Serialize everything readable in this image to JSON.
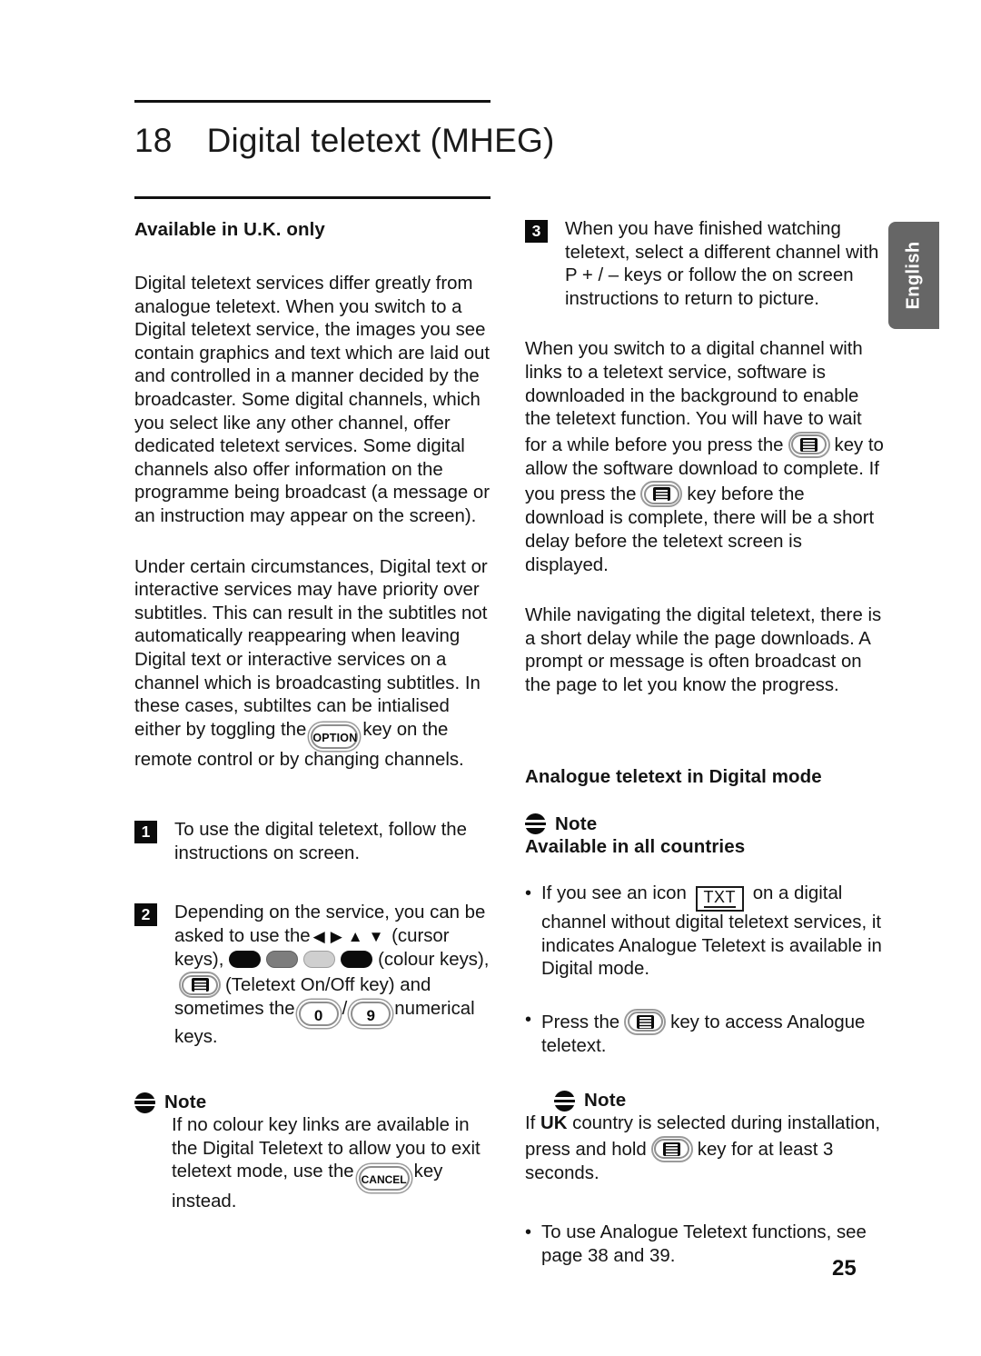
{
  "header": {
    "chapter_number": "18",
    "chapter_title": "Digital teletext (MHEG)"
  },
  "language_tab": {
    "label": "English"
  },
  "page_number": "25",
  "left_column": {
    "section_heading": "Available in U.K. only",
    "paragraph_1": "Digital teletext services differ greatly from analogue teletext. When you switch to a Digital teletext service, the images you see contain graphics and text which are laid out and controlled in a manner decided by the broadcaster. Some digital channels, which you select like any other channel, offer dedicated teletext services. Some digital channels also offer information on the programme being broadcast (a message or an instruction may appear on the screen).",
    "paragraph_2_part_1": "Under certain circumstances, Digital text or interactive services may have priority over subtitles. This can result in the subtitles not automatically reappearing when leaving Digital text or interactive services on a channel which is broadcasting subtitles. In these cases, subtiltes can be intialised either by toggling the",
    "paragraph_2_part_2": "key on the remote control or by changing channels.",
    "option_key_label": "OPTION",
    "step_1": {
      "number": "1",
      "text": "To use the digital teletext, follow the instructions on screen."
    },
    "step_2": {
      "number": "2",
      "text_part_1": "Depending on the service, you can be asked to use the",
      "text_part_2": "(cursor keys),",
      "text_part_3": "(colour keys),",
      "text_part_4": "(Teletext On/Off key) and",
      "text_part_5": "sometimes the",
      "text_part_6": "/",
      "text_part_7": "numerical keys.",
      "cursor_left": "◀",
      "cursor_right": "▶",
      "cursor_up": "▲",
      "cursor_down": "▼",
      "num_key_0": "0",
      "num_key_9": "9"
    },
    "note": {
      "label": "Note",
      "text_part_1": "If no colour key links are available in the Digital Teletext to allow you to exit teletext mode, use the",
      "text_part_2": "key instead.",
      "cancel_key_label": "CANCEL"
    }
  },
  "right_column": {
    "step_3": {
      "number": "3",
      "text": "When you have finished watching teletext, select a different channel with P + / –  keys or follow the on screen instructions to return to picture."
    },
    "paragraph_1_part_1": "When you switch to a digital channel with links to a teletext service, software is downloaded in the background to enable the teletext function. You will have to wait for a while before you press the",
    "paragraph_1_part_2": "key to allow the software download to complete. If you press the",
    "paragraph_1_part_3": "key before the download is complete, there will be a short delay before the teletext screen is displayed.",
    "paragraph_2": "While navigating the digital teletext, there is a short delay while the page downloads. A prompt or message is often broadcast on the page to let you know the progress.",
    "section_heading": "Analogue teletext in Digital mode",
    "note_1": {
      "label": "Note",
      "subheading": "Available in all countries"
    },
    "bullet_1_part_1": "If you see an icon",
    "bullet_1_part_2": "on a digital channel without digital teletext services, it indicates Analogue Teletext is available in Digital mode.",
    "txt_icon_label": "TXT",
    "bullet_2_part_1": "Press the",
    "bullet_2_part_2": "key to access Analogue teletext.",
    "note_2": {
      "label": "Note",
      "text_part_1": "If",
      "text_bold": "UK",
      "text_part_2": "country is selected during installation, press and hold",
      "text_part_3": "key for at least 3 seconds."
    },
    "bullet_3": "To use Analogue Teletext functions, see page 38 and 39.",
    "bullet_marker": "•"
  }
}
